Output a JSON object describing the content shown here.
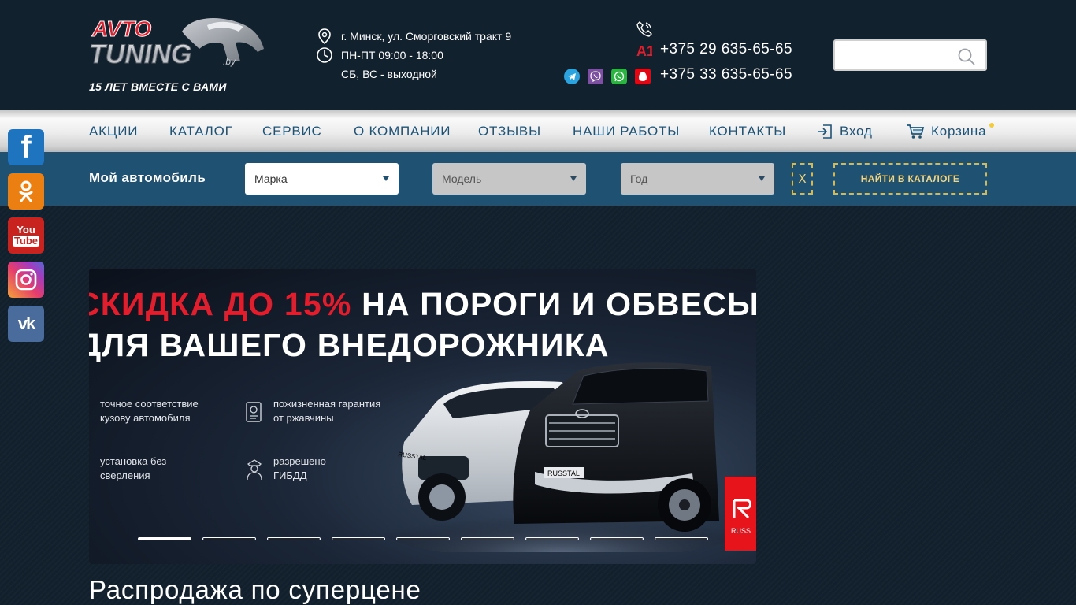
{
  "header": {
    "logo": {
      "line1": "AVTO",
      "line2": "TUNING",
      "domain": ".by",
      "tagline": "15 ЛЕТ ВМЕСТЕ С ВАМИ"
    },
    "address": "г. Минск, ул. Сморговский тракт 9",
    "hours_weekdays": "ПН-ПТ 09:00 - 18:00",
    "hours_weekend": "СБ, ВС - выходной",
    "phone1": "+375 29 635-65-65",
    "phone2": "+375 33 635-65-65",
    "a1_label": "A1",
    "search": {
      "placeholder": ""
    }
  },
  "nav": {
    "items": [
      "АКЦИИ",
      "КАТАЛОГ",
      "СЕРВИС",
      "О КОМПАНИИ",
      "ОТЗЫВЫ",
      "НАШИ РАБОТЫ",
      "КОНТАКТЫ"
    ],
    "login": "Вход",
    "cart": "Корзина"
  },
  "filter": {
    "label": "Мой автомобиль",
    "make": "Марка",
    "model": "Модель",
    "year": "Год",
    "reset": "X",
    "find": "НАЙТИ В КАТАЛОГЕ"
  },
  "social": [
    "facebook",
    "odnoklassniki",
    "youtube",
    "instagram",
    "vkontakte"
  ],
  "social_text": {
    "fb": "f",
    "yt_line1": "You",
    "yt_line2": "Tube",
    "vk": "vk"
  },
  "slider": {
    "headline1_red": "СКИДКА ДО 15%",
    "headline1_white": "НА ПОРОГИ И ОБВЕСЫ",
    "headline2": "ДЛЯ ВАШЕГО ВНЕДОРОЖНИКА",
    "features": [
      "точное соответствие\nкузову автомобиля",
      "пожизненная гарантия\nот ржавчины",
      "установка без\nсверления",
      "разрешено\nГИБДД"
    ],
    "plate1": "RUSSTAL",
    "plate2": "RUSSTAL",
    "brand_badge": "RUSS",
    "slide_count": 9,
    "active_slide": 1
  },
  "section_title": "Распродажа по суперцене",
  "colors": {
    "bg": "#11202c",
    "nav_text": "#1c5478",
    "filter_bg": "#1f5173",
    "accent_gold": "#d9b84a",
    "brand_red": "#e31d2b"
  }
}
